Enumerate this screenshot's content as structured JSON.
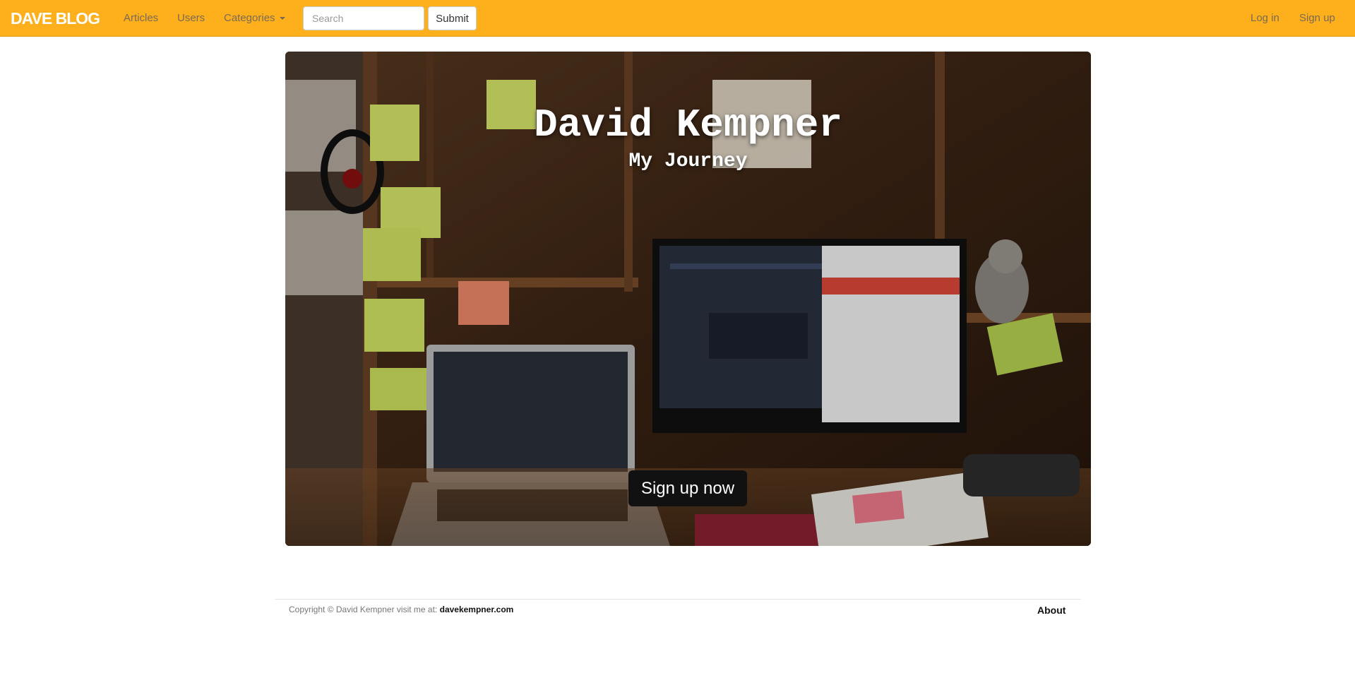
{
  "navbar": {
    "brand": "DAVE BLOG",
    "links": [
      {
        "label": "Articles"
      },
      {
        "label": "Users"
      },
      {
        "label": "Categories"
      }
    ],
    "search": {
      "placeholder": "Search",
      "value": ""
    },
    "submit_label": "Submit",
    "login_label": "Log in",
    "signup_label": "Sign up",
    "background_color": "#fdaf1c"
  },
  "hero": {
    "title": "David Kempner",
    "subtitle": "My Journey",
    "cta_label": "Sign up now"
  },
  "footer": {
    "copyright": "Copyright © David Kempner visit me at:",
    "site_link": "davekempner.com",
    "about_label": "About"
  },
  "icons": [
    "caret-down-icon"
  ]
}
